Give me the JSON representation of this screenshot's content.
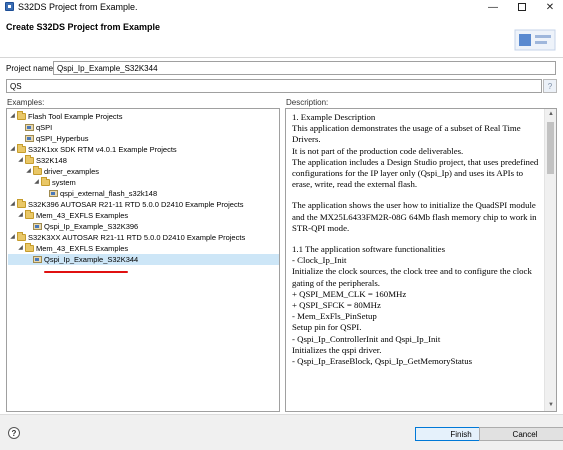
{
  "window": {
    "title": "S32DS Project from Example.",
    "min_glyph": "—",
    "close_glyph": "✕",
    "icon": "s32ds-app-icon"
  },
  "header": {
    "title": "Create S32DS Project from Example",
    "logo_icon": "wizard-banner-icon"
  },
  "project_name": {
    "label": "Project name:",
    "value": "Qspi_Ip_Example_S32K344"
  },
  "filter": {
    "value": "QS",
    "button_icon": "filter-icon",
    "button_glyph": "?"
  },
  "examples": {
    "label": "Examples:",
    "tree": [
      {
        "label": "Flash Tool Example Projects",
        "type": "folder",
        "expanded": true
      },
      {
        "label": "qSPI",
        "type": "project"
      },
      {
        "label": "qSPI_Hyperbus",
        "type": "project"
      },
      {
        "label": "S32K1xx SDK RTM v4.0.1 Example Projects",
        "type": "folder",
        "expanded": true
      },
      {
        "label": "S32K148",
        "type": "folder",
        "expanded": true
      },
      {
        "label": "driver_examples",
        "type": "folder",
        "expanded": true
      },
      {
        "label": "system",
        "type": "folder",
        "expanded": true
      },
      {
        "label": "qspi_external_flash_s32k148",
        "type": "project"
      },
      {
        "label": "S32K396 AUTOSAR R21-11 RTD 5.0.0 D2410 Example Projects",
        "type": "folder",
        "expanded": true
      },
      {
        "label": "Mem_43_EXFLS Examples",
        "type": "folder",
        "expanded": true
      },
      {
        "label": "Qspi_Ip_Example_S32K396",
        "type": "project"
      },
      {
        "label": "S32K3XX AUTOSAR R21-11 RTD 5.0.0 D2410 Example Projects",
        "type": "folder",
        "expanded": true
      },
      {
        "label": "Mem_43_EXFLS Examples",
        "type": "folder",
        "expanded": true
      },
      {
        "label": "Qspi_Ip_Example_S32K344",
        "type": "project",
        "selected": true
      }
    ]
  },
  "description": {
    "label": "Description:",
    "lines": [
      "1. Example Description",
      "This application demonstrates the usage of a subset of Real Time Drivers.",
      "It is not part of the production code deliverables.",
      "The application includes a Design Studio project, that uses predefined configurations for the IP layer only (Qspi_Ip) and uses its APIs to erase, write, read the external flash.",
      "",
      "The application shows the user how to initialize the QuadSPI module and the MX25L6433FM2R-08G 64Mb flash memory chip to work in STR-QPI mode.",
      "",
      "1.1 The application software functionalities",
      "- Clock_Ip_Init",
      "Initialize the clock sources, the clock tree and to configure the clock gating of the peripherals.",
      "+ QSPI_MEM_CLK = 160MHz",
      "+ QSPI_SFCK = 80MHz",
      "- Mem_ExFls_PinSetup",
      "Setup pin for QSPI.",
      "- Qspi_Ip_ControllerInit and Qspi_Ip_Init",
      "Initializes the qspi driver.",
      "- Qspi_Ip_EraseBlock, Qspi_Ip_GetMemoryStatus"
    ]
  },
  "buttons": {
    "help_glyph": "?",
    "finish": "Finish",
    "cancel": "Cancel"
  },
  "colors": {
    "selection": "#cde6f7",
    "accent": "#0078d7",
    "annotation_underline": "#e01010"
  }
}
